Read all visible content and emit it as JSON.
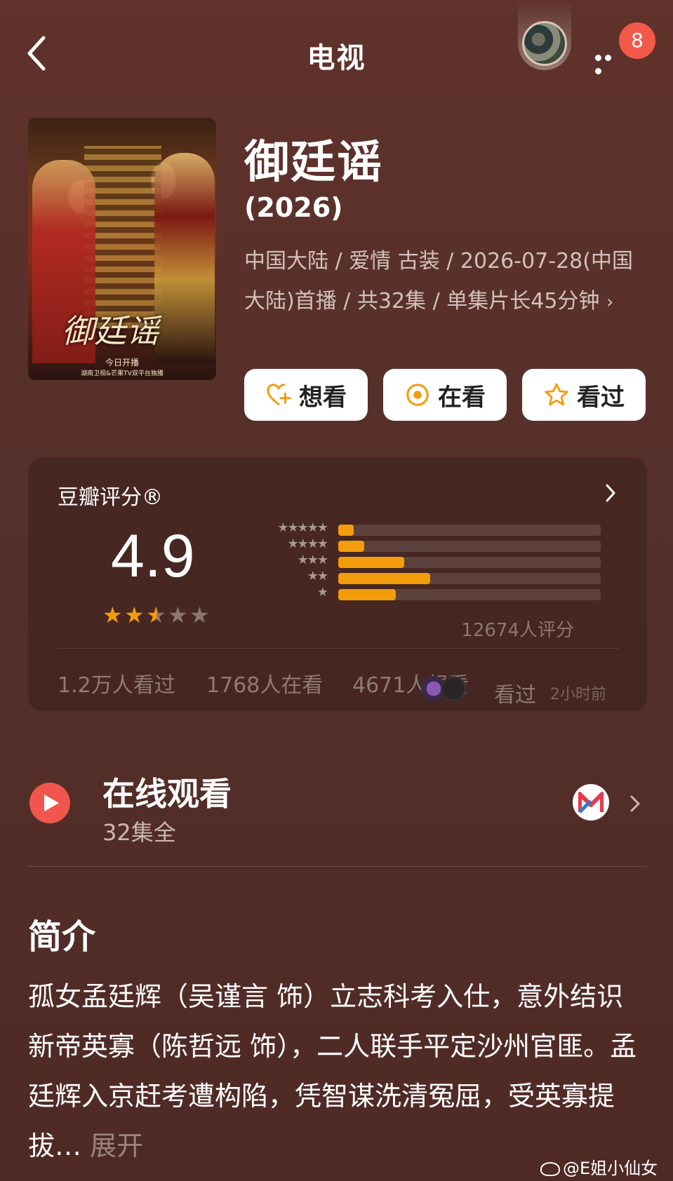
{
  "header": {
    "title": "电视",
    "notification_count": "8"
  },
  "show": {
    "poster_title": "御廷谣",
    "poster_tagline": "今日开播",
    "poster_channel": "湖南卫视&芒果TV双平台独播",
    "title": "御廷谣",
    "year": "(2026)",
    "meta": "中国大陆 / 爱情 古装 / 2026-07-28(中国大陆)首播 / 共32集 / 单集片长45分钟",
    "meta_chevron": "›"
  },
  "actions": [
    {
      "label": "想看",
      "icon": "heart-plus-icon"
    },
    {
      "label": "在看",
      "icon": "target-icon"
    },
    {
      "label": "看过",
      "icon": "star-outline-icon"
    }
  ],
  "rating": {
    "title": "豆瓣评分®",
    "score": "4.9",
    "score_stars": 2.5,
    "distribution": [
      {
        "stars": "★★★★★",
        "fraction": 0.06
      },
      {
        "stars": "★★★★",
        "fraction": 0.1
      },
      {
        "stars": "★★★",
        "fraction": 0.25
      },
      {
        "stars": "★★",
        "fraction": 0.35
      },
      {
        "stars": "★",
        "fraction": 0.22
      }
    ],
    "votes": "12674人评分",
    "watched": "1.2万人看过",
    "watching": "1768人在看",
    "wish": "4671人想看",
    "recent_label": "看过",
    "recent_time": "2小时前"
  },
  "online": {
    "title": "在线观看",
    "subtitle": "32集全"
  },
  "intro": {
    "heading": "简介",
    "text": "孤女孟廷辉（吴谨言 饰）立志科考入仕，意外结识新帝英寡（陈哲远 饰），二人联手平定沙州官匪。孟廷辉入京赶考遭构陷，凭智谋洗清冤屈，受英寡提拔…",
    "more": " 展开"
  },
  "watermark": "@E姐小仙女",
  "colors": {
    "accent": "#f39c0c",
    "badge": "#f2594b",
    "background": "#5a2f29"
  }
}
